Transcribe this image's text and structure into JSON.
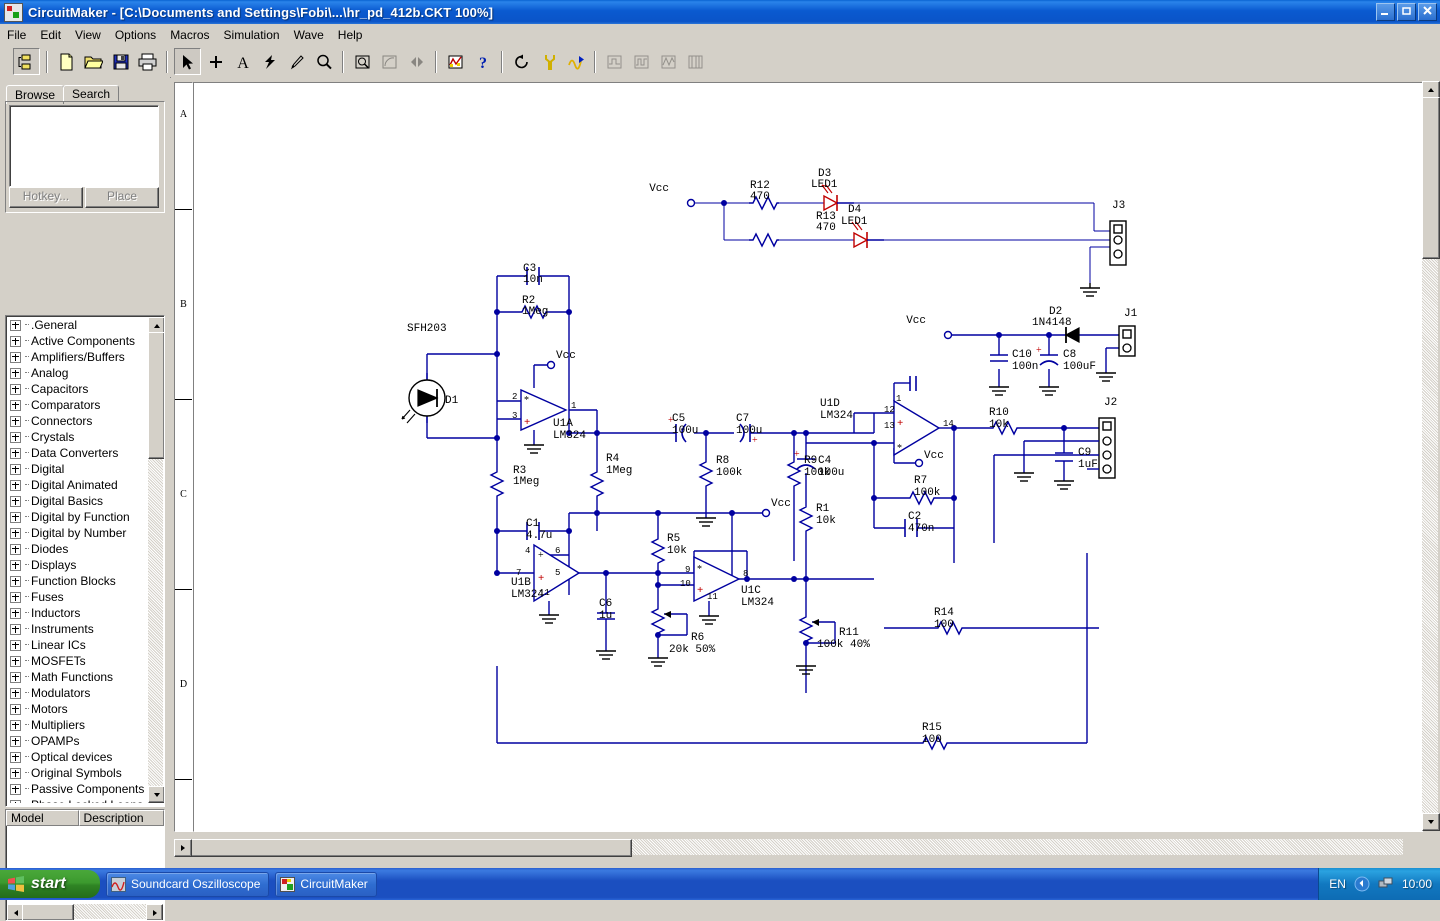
{
  "window": {
    "app_name": "CircuitMaker",
    "title": "CircuitMaker - [C:\\Documents and Settings\\Fobi\\...\\hr_pd_412b.CKT 100%]",
    "minimize": "–",
    "restore": "❐",
    "close": "✕"
  },
  "menu": [
    "File",
    "Edit",
    "View",
    "Options",
    "Macros",
    "Simulation",
    "Wave",
    "Help"
  ],
  "toolbar": {
    "groups": [
      [
        {
          "name": "project-icon",
          "tip": "Project"
        }
      ],
      [
        {
          "name": "new-file-icon",
          "tip": "New"
        },
        {
          "name": "open-folder-icon",
          "tip": "Open"
        },
        {
          "name": "save-disk-icon",
          "tip": "Save"
        },
        {
          "name": "print-icon",
          "tip": "Print"
        }
      ],
      [
        {
          "name": "arrow-select-icon",
          "tip": "Select",
          "pressed": true
        },
        {
          "name": "wire-cross-icon",
          "tip": "Wire"
        },
        {
          "name": "text-icon",
          "tip": "Text"
        },
        {
          "name": "bolt-icon",
          "tip": "Probe"
        },
        {
          "name": "pencil-probe-icon",
          "tip": "Pen"
        },
        {
          "name": "magnifier-icon",
          "tip": "Zoom"
        }
      ],
      [
        {
          "name": "zoom-window-icon",
          "tip": "Zoom Window"
        },
        {
          "name": "measure-icon",
          "tip": "Measure",
          "disabled": true
        },
        {
          "name": "step-icon",
          "tip": "Step",
          "disabled": true
        }
      ],
      [
        {
          "name": "simulate-icon",
          "tip": "Simulate"
        },
        {
          "name": "help-question-icon",
          "tip": "Help"
        }
      ],
      [
        {
          "name": "reset-icon",
          "tip": "Reset"
        },
        {
          "name": "tools-icon",
          "tip": "Tools"
        },
        {
          "name": "run-analog-icon",
          "tip": "Run"
        }
      ],
      [
        {
          "name": "waveform-1-icon",
          "tip": "Waveform",
          "disabled": true
        },
        {
          "name": "waveform-2-icon",
          "tip": "Waveform",
          "disabled": true
        },
        {
          "name": "waveform-3-icon",
          "tip": "Waveform",
          "disabled": true
        },
        {
          "name": "waveform-4-icon",
          "tip": "Waveform",
          "disabled": true
        }
      ]
    ]
  },
  "sidebar": {
    "tabs": [
      {
        "label": "Browse",
        "active": true
      },
      {
        "label": "Search",
        "active": false
      }
    ],
    "buttons": [
      {
        "label": "Hotkey...",
        "enabled": false
      },
      {
        "label": "Place",
        "enabled": false
      }
    ],
    "tree": [
      ".General",
      "Active Components",
      "Amplifiers/Buffers",
      "Analog",
      "Capacitors",
      "Comparators",
      "Connectors",
      "Crystals",
      "Data Converters",
      "Digital",
      "Digital Animated",
      "Digital Basics",
      "Digital by Function",
      "Digital by Number",
      "Diodes",
      "Displays",
      "Function Blocks",
      "Fuses",
      "Inductors",
      "Instruments",
      "Linear ICs",
      "MOSFETs",
      "Math Functions",
      "Modulators",
      "Motors",
      "Multipliers",
      "OPAMPs",
      "Optical devices",
      "Original Symbols",
      "Passive Components",
      "Phase Locked Loops"
    ],
    "model_table": {
      "columns": [
        "Model",
        "Description"
      ],
      "rows": []
    }
  },
  "canvas": {
    "ruler_labels": [
      "A",
      "B",
      "C",
      "D"
    ],
    "zoom": "100%"
  },
  "schematic": {
    "title": "hr_pd_412b.CKT",
    "wire_color": "#0000a0",
    "diode_color": "#c00000",
    "text_color": "#000000",
    "components": [
      {
        "ref": "D1",
        "value": "SFH203",
        "type": "photodiode"
      },
      {
        "ref": "D2",
        "value": "1N4148",
        "type": "diode"
      },
      {
        "ref": "D3",
        "value": "LED1",
        "type": "led"
      },
      {
        "ref": "D4",
        "value": "LED1",
        "type": "led"
      },
      {
        "ref": "R1",
        "value": "10k",
        "type": "resistor"
      },
      {
        "ref": "R2",
        "value": "1Meg",
        "type": "resistor"
      },
      {
        "ref": "R3",
        "value": "1Meg",
        "type": "resistor"
      },
      {
        "ref": "R4",
        "value": "1Meg",
        "type": "resistor"
      },
      {
        "ref": "R5",
        "value": "10k",
        "type": "resistor"
      },
      {
        "ref": "R6",
        "value": "20k 50%",
        "type": "potentiometer"
      },
      {
        "ref": "R7",
        "value": "100k",
        "type": "resistor"
      },
      {
        "ref": "R8",
        "value": "100k",
        "type": "resistor"
      },
      {
        "ref": "R9",
        "value": "100k",
        "type": "resistor"
      },
      {
        "ref": "R10",
        "value": "10k",
        "type": "resistor"
      },
      {
        "ref": "R11",
        "value": "100k 40%",
        "type": "potentiometer"
      },
      {
        "ref": "R12",
        "value": "470",
        "type": "resistor"
      },
      {
        "ref": "R13",
        "value": "470",
        "type": "resistor"
      },
      {
        "ref": "R14",
        "value": "100",
        "type": "resistor"
      },
      {
        "ref": "R15",
        "value": "100",
        "type": "resistor"
      },
      {
        "ref": "C1",
        "value": "4.7u",
        "type": "capacitor"
      },
      {
        "ref": "C2",
        "value": "470n",
        "type": "capacitor"
      },
      {
        "ref": "C3",
        "value": "10n",
        "type": "capacitor"
      },
      {
        "ref": "C4",
        "value": "100u",
        "type": "capacitor-polarized"
      },
      {
        "ref": "C5",
        "value": "100u",
        "type": "capacitor-polarized"
      },
      {
        "ref": "C6",
        "value": "1u",
        "type": "capacitor"
      },
      {
        "ref": "C7",
        "value": "100u",
        "type": "capacitor-polarized"
      },
      {
        "ref": "C8",
        "value": "100uF",
        "type": "capacitor-polarized"
      },
      {
        "ref": "C9",
        "value": "1uF",
        "type": "capacitor"
      },
      {
        "ref": "C10",
        "value": "100n",
        "type": "capacitor"
      },
      {
        "ref": "U1A",
        "value": "LM324",
        "type": "opamp",
        "pins": [
          "2",
          "3",
          "1"
        ]
      },
      {
        "ref": "U1B",
        "value": "LM324",
        "type": "opamp",
        "pins": [
          "7",
          "6",
          "5",
          "4",
          "11"
        ]
      },
      {
        "ref": "U1C",
        "value": "LM324",
        "type": "opamp",
        "pins": [
          "9",
          "10",
          "8"
        ]
      },
      {
        "ref": "U1D",
        "value": "LM324",
        "type": "opamp",
        "pins": [
          "12",
          "13",
          "14"
        ]
      },
      {
        "ref": "J1",
        "value": "",
        "type": "connector"
      },
      {
        "ref": "J2",
        "value": "",
        "type": "connector"
      },
      {
        "ref": "J3",
        "value": "",
        "type": "connector"
      }
    ],
    "nets": [
      "Vcc"
    ],
    "labels": {
      "vcc": "Vcc",
      "sfh203": "SFH203",
      "lm324": "LM324"
    }
  },
  "taskbar": {
    "start_label": "start",
    "items": [
      {
        "label": "Soundcard Oszilloscope",
        "icon": "oscilloscope-icon"
      },
      {
        "label": "CircuitMaker",
        "icon": "circuitmaker-icon",
        "active": true
      }
    ],
    "tray": {
      "language": "EN",
      "clock": "10:00"
    }
  }
}
